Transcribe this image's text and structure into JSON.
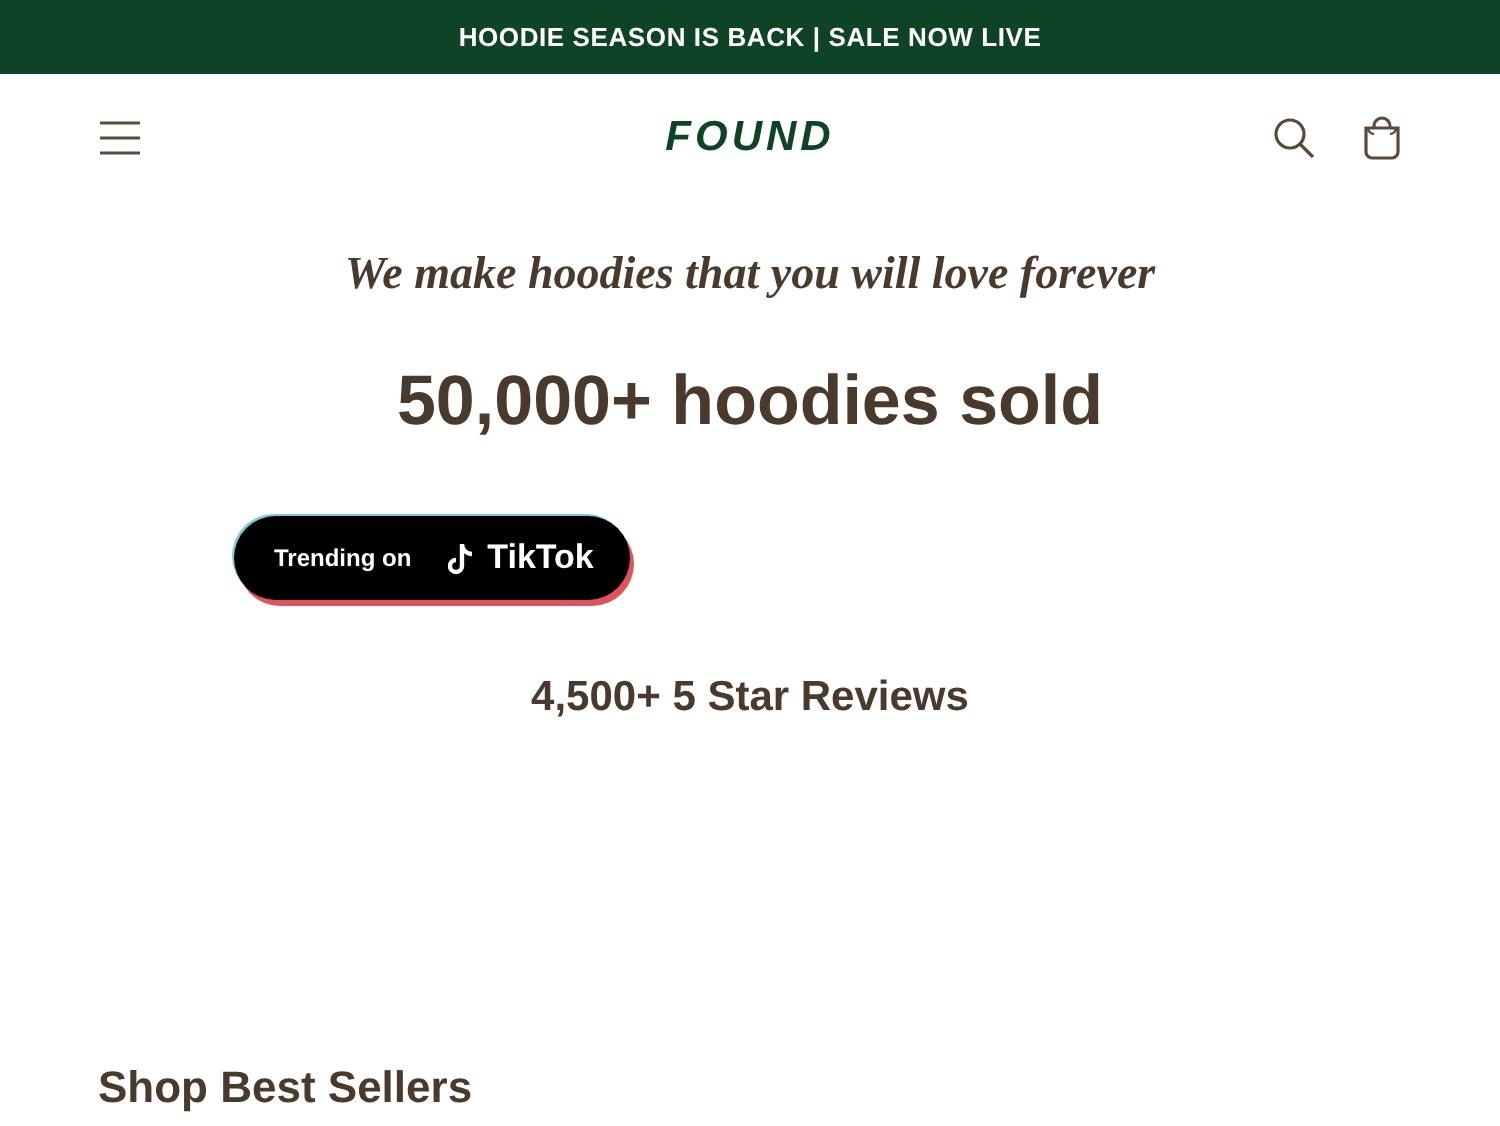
{
  "announcement": "HOODIE SEASON IS BACK | SALE NOW LIVE",
  "header": {
    "logo": "FOUND"
  },
  "hero": {
    "tagline": "We make hoodies that you will love forever",
    "headline": "50,000+ hoodies sold",
    "badge": {
      "prefix": "Trending on",
      "brand": "TikTok"
    },
    "reviews": "4,500+ 5 Star Reviews"
  },
  "section_title": "Shop Best Sellers"
}
